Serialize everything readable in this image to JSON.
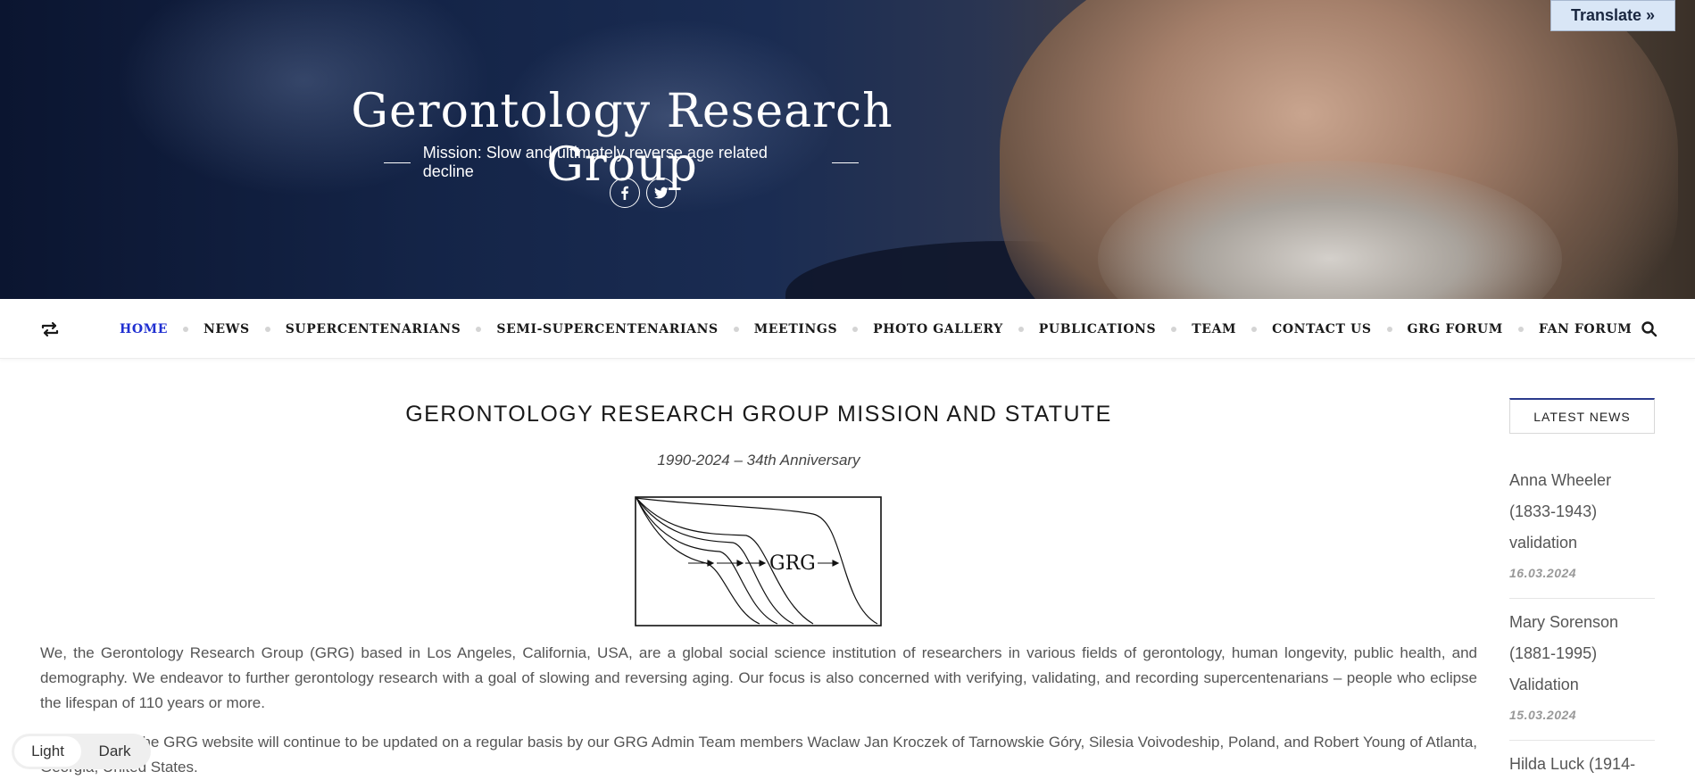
{
  "header": {
    "title": "Gerontology Research Group",
    "mission": "Mission: Slow and ultimately reverse age related decline",
    "social_icons": [
      "facebook-icon",
      "twitter-icon"
    ],
    "translate_label": "Translate »"
  },
  "nav": {
    "items": [
      {
        "label": "HOME",
        "active": true
      },
      {
        "label": "NEWS"
      },
      {
        "label": "SUPERCENTENARIANS"
      },
      {
        "label": "SEMI-SUPERCENTENARIANS"
      },
      {
        "label": "MEETINGS"
      },
      {
        "label": "PHOTO GALLERY"
      },
      {
        "label": "PUBLICATIONS"
      },
      {
        "label": "TEAM"
      },
      {
        "label": "CONTACT US"
      },
      {
        "label": "GRG FORUM"
      },
      {
        "label": "FAN FORUM"
      }
    ],
    "active_color": "#1f2fd1"
  },
  "main": {
    "heading": "GERONTOLOGY RESEARCH GROUP MISSION AND STATUTE",
    "subheading": "1990-2024 – 34th Anniversary",
    "figure_label": "GRG",
    "paragraph1": "We, the Gerontology Research Group (GRG) based in Los Angeles, California, USA, are a global social science institution of researchers in various fields of gerontology, human longevity, public health, and demography. We endeavor to further gerontology research with a goal of slowing and reversing aging. Our focus is also concerned with verifying, validating, and recording supercentenarians – people who eclipse the lifespan of 110 years or more.",
    "paragraph2": "The LISTS on the GRG website will continue to be updated on a regular basis by our GRG Admin Team members Waclaw Jan Kroczek of Tarnowskie Góry, Silesia Voivodeship, Poland, and Robert Young of Atlanta, Georgia, United States."
  },
  "sidebar": {
    "title": "LATEST NEWS",
    "news": [
      {
        "title_lines": [
          "Anna Wheeler",
          "(1833-1943)",
          "validation"
        ],
        "date": "16.03.2024"
      },
      {
        "title_lines": [
          "Mary Sorenson",
          "(1881-1995)",
          "Validation"
        ],
        "date": "15.03.2024"
      },
      {
        "title_lines": [
          "Hilda Luck (1914-"
        ]
      }
    ]
  },
  "theme_toggle": {
    "light": "Light",
    "dark": "Dark"
  }
}
